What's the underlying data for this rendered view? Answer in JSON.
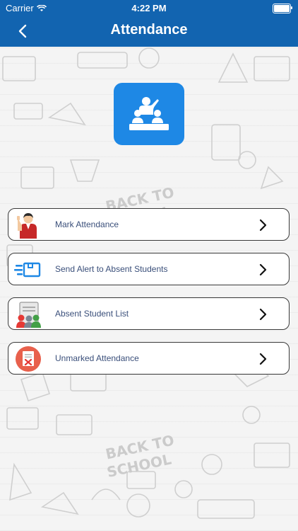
{
  "status_bar": {
    "carrier": "Carrier",
    "time": "4:22 PM"
  },
  "header": {
    "title": "Attendance",
    "back_icon": "chevron-left-icon",
    "background": "#1264b0"
  },
  "hero_icon": {
    "name": "classroom-icon",
    "background": "#1e88e5"
  },
  "background_watermark": "BACK TO SCHOOL",
  "menu": [
    {
      "label": "Mark Attendance",
      "icon": "teacher-icon"
    },
    {
      "label": "Send Alert to Absent Students",
      "icon": "send-alert-icon"
    },
    {
      "label": "Absent Student List",
      "icon": "student-list-icon"
    },
    {
      "label": "Unmarked Attendance",
      "icon": "unmarked-document-icon"
    }
  ]
}
